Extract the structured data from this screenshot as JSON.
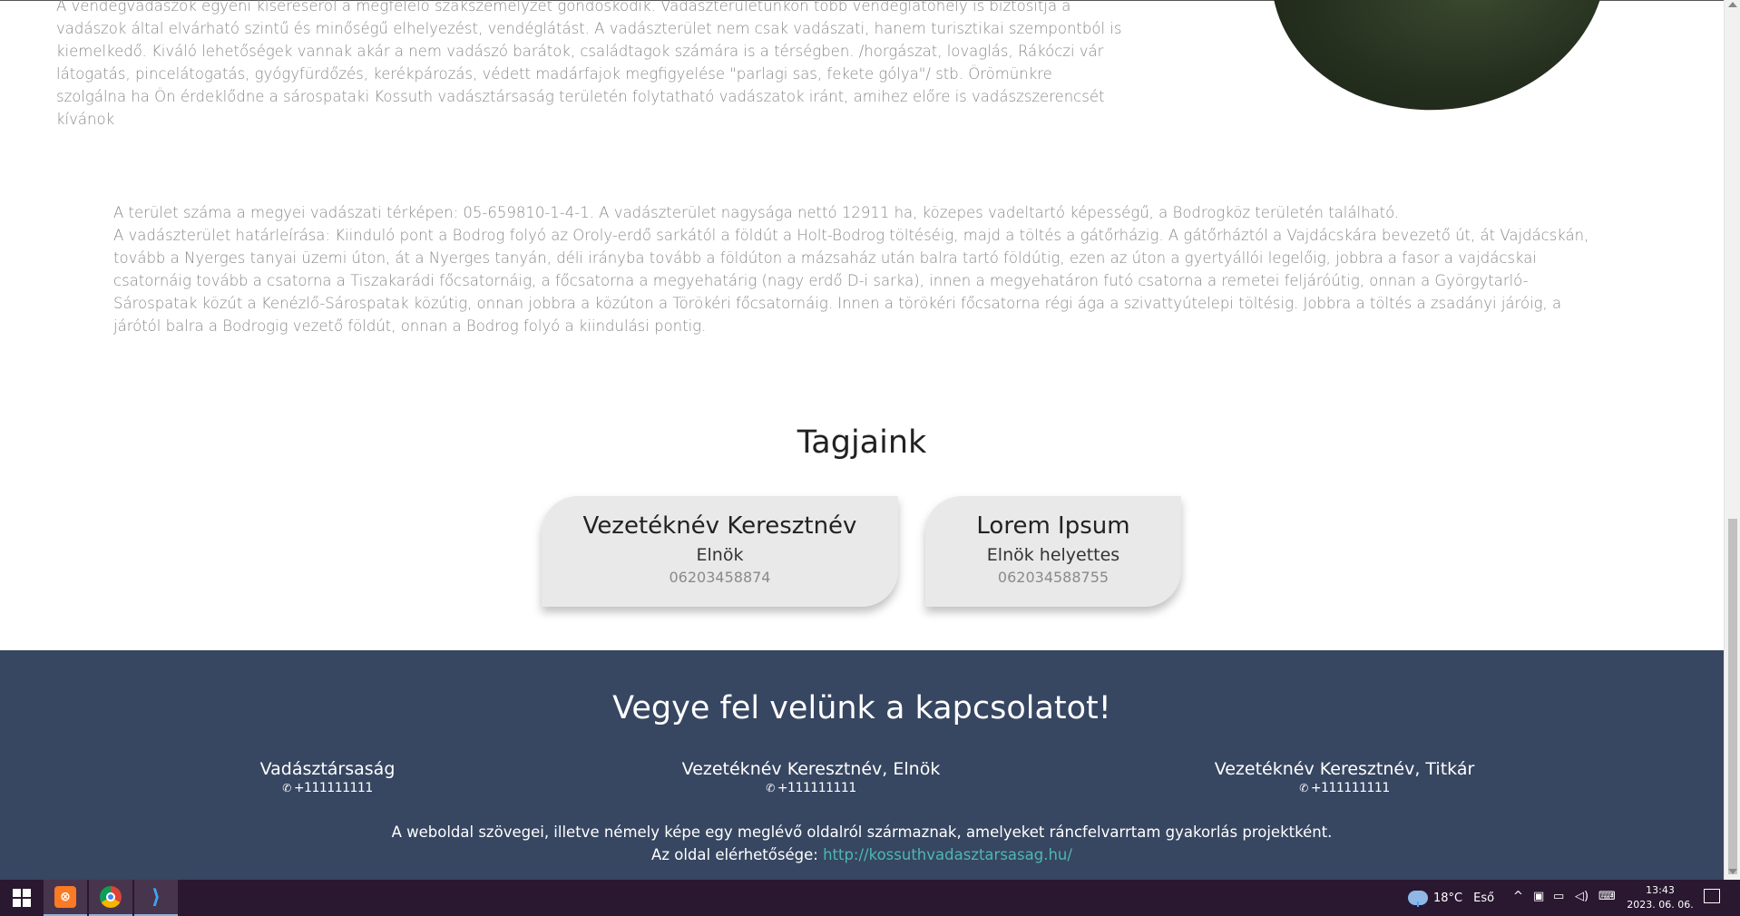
{
  "intro": {
    "paragraph": "A vendégvadászok egyéni kíséréséről a megfelelő szakszemélyzet gondoskodik. Vadászterületünkön több vendéglátóhely is biztosítja a vadászok által elvárható szintű és minőségű elhelyezést, vendéglátást. A vadászterület nem csak vadászati, hanem turisztikai szempontból is kiemelkedő. Kiváló lehetőségek vannak akár a nem vadászó barátok, családtagok számára is a térségben. /horgászat, lovaglás, Rákóczi vár látogatás, pincelátogatás, gyógyfürdőzés, kerékpározás, védett madárfajok megfigyelése \"parlagi sas, fekete gólya\"/ stb. Örömünkre szolgálna ha Ön érdeklődne a sárospataki Kossuth vadásztársaság területén folytatható vadászatok iránt, amihez előre is vadászszerencsét kívánok"
  },
  "area": {
    "line1": "A terület száma a megyei vadászati térképen: 05-659810-1-4-1. A vadászterület nagysága nettó 12911 ha, közepes vadeltartó képességű, a Bodrogköz területén található.",
    "line2": "A vadászterület határleírása: Kiinduló pont a Bodrog folyó az Oroly-erdő sarkától a földút a Holt-Bodrog töltéséig, majd a töltés a gátőrházig. A gátőrháztól a Vajdácskára bevezető út, át Vajdácskán, tovább a Nyerges tanyai üzemi úton, át a Nyerges tanyán, déli irányba tovább a földúton a mázsaház után balra tartó földútig, ezen az úton a gyertyállói legelőig, jobbra a fasor a vajdácskai csatornáig tovább a csatorna a Tiszakarádi főcsatornáig, a főcsatorna a megyehatárig (nagy erdő D-i sarka), innen a megyehatáron futó csatorna a remetei feljáróútig, onnan a Györgytarló-Sárospatak közút a Kenézlő-Sárospatak közútig, onnan jobbra a közúton a Törökéri főcsatornáig. Innen a törökéri főcsatorna régi ága a szivattyútelepi töltésig. Jobbra a töltés a zsadányi járóig, a járótól balra a Bodrogig vezető földút, onnan a Bodrog folyó a kiindulási pontig."
  },
  "members": {
    "title": "Tagjaink",
    "items": [
      {
        "name": "Vezetéknév Keresztnév",
        "role": "Elnök",
        "phone": "06203458874"
      },
      {
        "name": "Lorem Ipsum",
        "role": "Elnök helyettes",
        "phone": "062034588755"
      }
    ]
  },
  "contact": {
    "title": "Vegye fel velünk a kapcsolatot!",
    "columns": [
      {
        "name": "Vadásztársaság",
        "phone": "+111111111"
      },
      {
        "name": "Vezetéknév Keresztnév, Elnök",
        "phone": "+111111111"
      },
      {
        "name": "Vezetéknév Keresztnév, Titkár",
        "phone": "+111111111"
      }
    ],
    "phone_icon": "phone-icon",
    "note_line1": "A weboldal szövegei, illetve némely képe egy meglévő oldalról származnak, amelyeket ráncfelvarrtam gyakorlás projektként.",
    "note_prefix": "Az oldal elérhetősége: ",
    "note_link": "http://kossuthvadasztarsasag.hu/"
  },
  "taskbar": {
    "apps": [
      "windows-start",
      "xampp",
      "chrome",
      "vscode"
    ],
    "weather_temp": "18°C",
    "weather_desc": "Eső",
    "time": "13:43",
    "date": "2023. 06. 06.",
    "notification_count": "1"
  },
  "colors": {
    "contact_bg": "#374661",
    "link": "#4db8b0",
    "taskbar_bg": "#2a1830",
    "card_bg": "#e9e9e9"
  }
}
